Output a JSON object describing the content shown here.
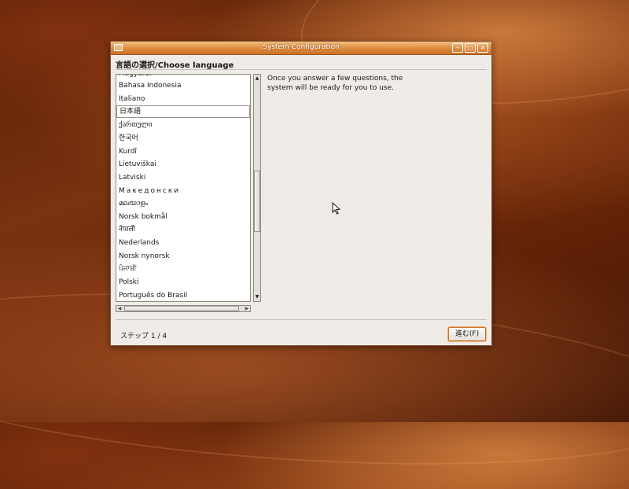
{
  "window": {
    "title": "System Configuration"
  },
  "heading": "言語の選択/Choose language",
  "languages": [
    "Magyarul",
    "Bahasa Indonesia",
    "Italiano",
    "日本語",
    "ქართული",
    "한국어",
    "Kurdî",
    "Lietuviškai",
    "Latviski",
    "Македонски",
    "മലയാളം",
    "Norsk bokmål",
    "नेपाली",
    "Nederlands",
    "Norsk nynorsk",
    "ਪੰਜਾਬੀ",
    "Polski",
    "Português do Brasil"
  ],
  "selected_language": "日本語",
  "info_text": "Once you answer a few questions, the system will be ready for you to use.",
  "step_label": "ステップ 1 / 4",
  "next_button": "進む(F)"
}
